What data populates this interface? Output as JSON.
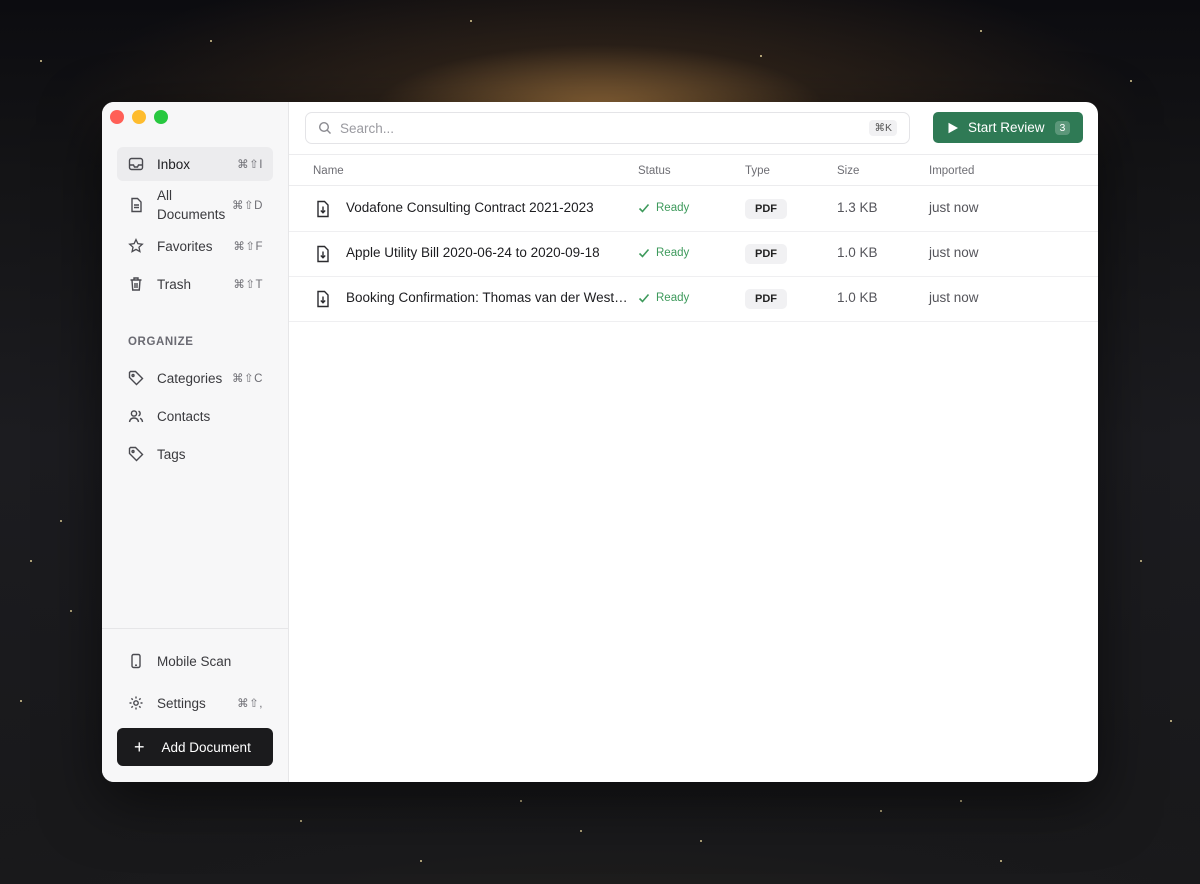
{
  "sidebar": {
    "nav": [
      {
        "label": "Inbox",
        "shortcut": "⌘⇧I",
        "icon": "inbox-icon",
        "active": true
      },
      {
        "label": "All Documents",
        "shortcut": "⌘⇧D",
        "icon": "document-icon"
      },
      {
        "label": "Favorites",
        "shortcut": "⌘⇧F",
        "icon": "star-icon"
      },
      {
        "label": "Trash",
        "shortcut": "⌘⇧T",
        "icon": "trash-icon"
      }
    ],
    "organize_title": "ORGANIZE",
    "organize": [
      {
        "label": "Categories",
        "shortcut": "⌘⇧C",
        "icon": "tag-icon"
      },
      {
        "label": "Contacts",
        "shortcut": "",
        "icon": "users-icon"
      },
      {
        "label": "Tags",
        "shortcut": "",
        "icon": "tags-icon"
      }
    ],
    "bottom": [
      {
        "label": "Mobile Scan",
        "shortcut": "",
        "icon": "phone-icon"
      },
      {
        "label": "Settings",
        "shortcut": "⌘⇧,",
        "icon": "gear-icon"
      }
    ],
    "add_document_label": "Add Document"
  },
  "toolbar": {
    "search_placeholder": "Search...",
    "search_shortcut": "⌘K",
    "review_label": "Start Review",
    "review_count": "3"
  },
  "table": {
    "columns": [
      "Name",
      "Status",
      "Type",
      "Size",
      "Imported"
    ],
    "rows": [
      {
        "name": "Vodafone Consulting Contract 2021-2023",
        "status": "Ready",
        "type": "PDF",
        "size": "1.3 KB",
        "imported": "just now"
      },
      {
        "name": "Apple Utility Bill 2020-06-24 to 2020-09-18",
        "status": "Ready",
        "type": "PDF",
        "size": "1.0 KB",
        "imported": "just now"
      },
      {
        "name": "Booking Confirmation: Thomas van der Westhuizen",
        "status": "Ready",
        "type": "PDF",
        "size": "1.0 KB",
        "imported": "just now"
      }
    ]
  },
  "colors": {
    "accent_green": "#2f7a55",
    "status_green": "#3e9a5c",
    "add_button": "#1b1b1d"
  }
}
